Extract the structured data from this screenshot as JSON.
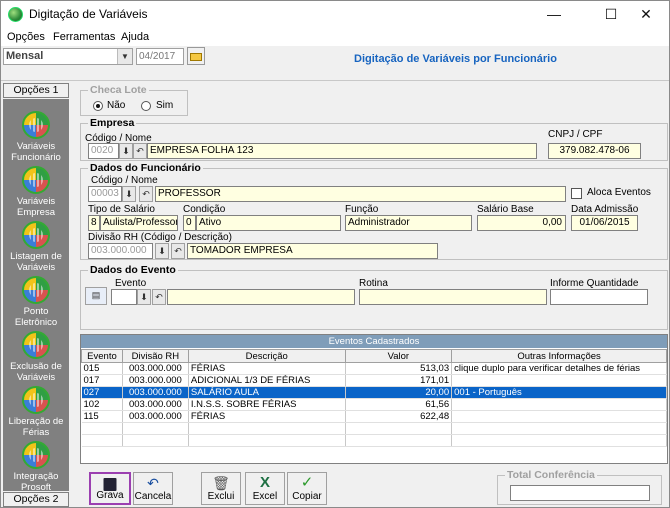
{
  "window": {
    "title": "Digitação de Variáveis",
    "minimize": "—",
    "maximize": "☐",
    "close": "✕"
  },
  "menu": {
    "items": [
      "Opções",
      "Ferramentas",
      "Ajuda"
    ]
  },
  "toolbar": {
    "period_select": "Mensal",
    "competencia": "04/2017",
    "heading": "Digitação de Variáveis por Funcionário"
  },
  "sidebar": {
    "header1": "Opções 1",
    "header2": "Opções 2",
    "items": [
      {
        "label": "Variáveis Funcionário"
      },
      {
        "label": "Variáveis Empresa"
      },
      {
        "label": "Listagem de Variáveis"
      },
      {
        "label": "Ponto Eletrônico"
      },
      {
        "label": "Exclusão de Variáveis"
      },
      {
        "label": "Liberação de Férias"
      },
      {
        "label": "Integração Prosoft"
      }
    ]
  },
  "checa_lote": {
    "label": "Checa Lote",
    "options": [
      "Não",
      "Sim"
    ],
    "selected": "Não"
  },
  "empresa": {
    "label": "Empresa",
    "code_name_label": "Código / Nome",
    "code": "0020",
    "name": "EMPRESA FOLHA 123",
    "cnpj_label": "CNPJ / CPF",
    "cnpj": "379.082.478-06"
  },
  "funcionario": {
    "label": "Dados do Funcionário",
    "code_name_label": "Código / Nome",
    "code": "00003",
    "name": "PROFESSOR",
    "aloca_label": "Aloca Eventos",
    "tipo_salario_label": "Tipo de Salário",
    "tipo_code": "8",
    "tipo_name": "Aulista/Professor",
    "condicao_label": "Condição",
    "condicao_code": "0",
    "condicao_name": "Ativo",
    "funcao_label": "Função",
    "funcao": "Administrador",
    "salario_label": "Salário Base",
    "salario": "0,00",
    "admissao_label": "Data Admissão",
    "admissao": "01/06/2015",
    "divisao_label": "Divisão RH (Código / Descrição)",
    "divisao_code": "003.000.000",
    "divisao_name": "TOMADOR EMPRESA"
  },
  "evento": {
    "label": "Dados do Evento",
    "evento_label": "Evento",
    "rotina_label": "Rotina",
    "quantidade_label": "Informe Quantidade"
  },
  "grid": {
    "title": "Eventos Cadastrados",
    "columns": [
      "Evento",
      "Divisão RH",
      "Descrição",
      "Valor",
      "Outras Informações"
    ],
    "rows": [
      [
        "015",
        "003.000.000",
        "FÉRIAS",
        "513,03",
        "clique duplo para verificar detalhes de férias"
      ],
      [
        "017",
        "003.000.000",
        "ADICIONAL 1/3 DE FÉRIAS",
        "171,01",
        ""
      ],
      [
        "027",
        "003.000.000",
        "SALÁRIO AULA",
        "20,00",
        "001 - Português"
      ],
      [
        "102",
        "003.000.000",
        "I.N.S.S. SOBRE FÉRIAS",
        "61,56",
        ""
      ],
      [
        "115",
        "003.000.000",
        "FÉRIAS",
        "622,48",
        ""
      ]
    ],
    "selected_row": 2
  },
  "buttons": {
    "grava": "Grava",
    "cancela": "Cancela",
    "exclui": "Exclui",
    "excel": "Excel",
    "copiar": "Copiar"
  },
  "total": {
    "label": "Total Conferência",
    "value": ""
  }
}
